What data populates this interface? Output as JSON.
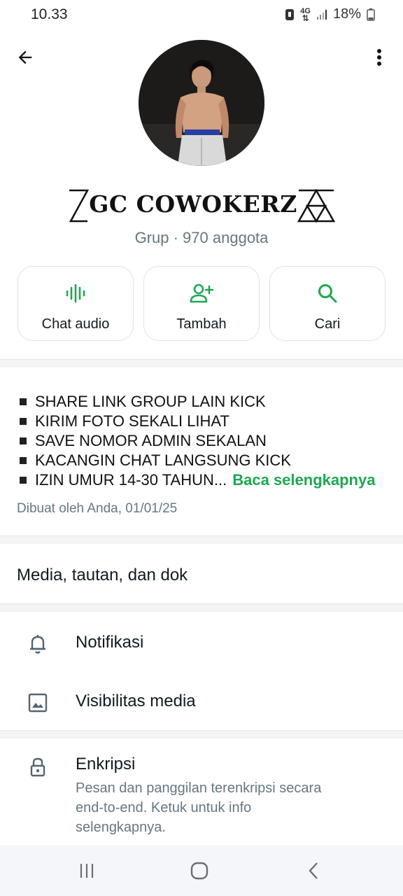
{
  "status_bar": {
    "time": "10.33",
    "network": "4G",
    "battery": "18%"
  },
  "header": {
    "back_icon": "arrow-left-icon",
    "more_icon": "more-vertical-icon"
  },
  "group": {
    "name": "GC COWOKERZ",
    "subtitle": "Grup · 970 anggota"
  },
  "actions": [
    {
      "label": "Chat audio",
      "icon": "audio-wave-icon"
    },
    {
      "label": "Tambah",
      "icon": "add-person-icon"
    },
    {
      "label": "Cari",
      "icon": "search-icon"
    }
  ],
  "description": {
    "lines": [
      "SHARE LINK GROUP LAIN KICK",
      "KIRIM FOTO SEKALI LIHAT",
      "SAVE NOMOR ADMIN SEKALAN",
      "KACANGIN CHAT LANGSUNG KICK",
      "IZIN UMUR 14-30 TAHUN..."
    ],
    "read_more": "Baca selengkapnya",
    "created": "Dibuat oleh Anda, 01/01/25"
  },
  "media": {
    "label": "Media, tautan, dan dok"
  },
  "settings": {
    "notifications": "Notifikasi",
    "media_visibility": "Visibilitas media",
    "encryption": "Enkripsi",
    "encryption_desc": "Pesan dan panggilan terenkripsi secara end-to-end. Ketuk untuk info selengkapnya."
  },
  "colors": {
    "accent": "#1da851",
    "secondary_text": "#667781"
  }
}
